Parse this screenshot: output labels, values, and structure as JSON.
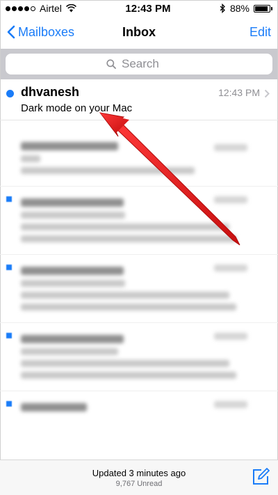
{
  "status_bar": {
    "carrier": "Airtel",
    "time": "12:43 PM",
    "battery_percent": "88%",
    "battery_level": 0.88
  },
  "nav": {
    "back_label": "Mailboxes",
    "title": "Inbox",
    "edit_label": "Edit"
  },
  "search": {
    "placeholder": "Search"
  },
  "messages": [
    {
      "sender": "dhvanesh",
      "time": "12:43 PM",
      "subject": "Dark mode on your Mac",
      "unread": true
    }
  ],
  "toolbar": {
    "updated_text": "Updated 3 minutes ago",
    "unread_count": "9,767 Unread"
  },
  "colors": {
    "accent": "#1a7cf8",
    "annotation_arrow": "#e21b1b"
  }
}
